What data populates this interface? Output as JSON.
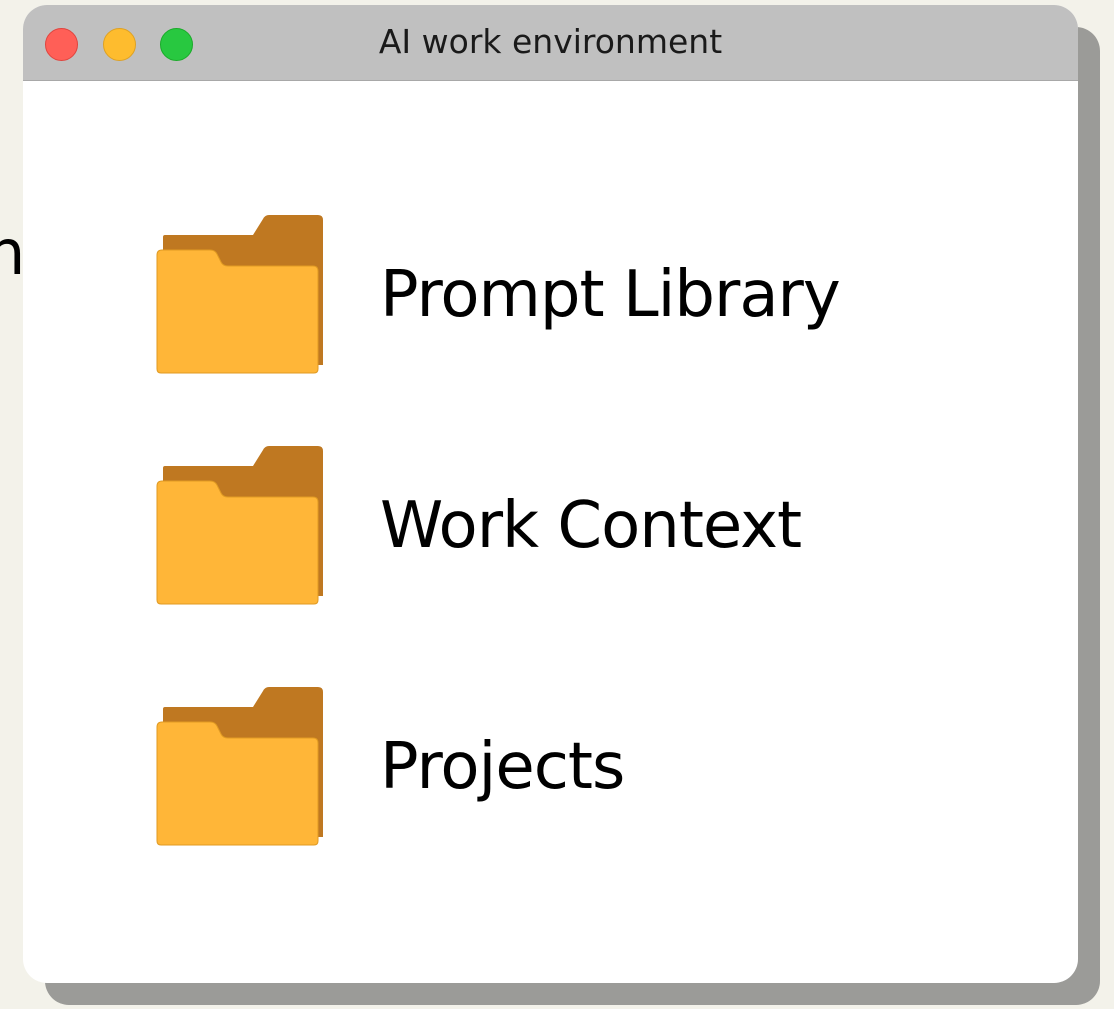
{
  "window": {
    "title": "AI work environment"
  },
  "background": {
    "partial_glyph": "n"
  },
  "folders": [
    {
      "label": "Prompt Library",
      "icon": "folder-icon"
    },
    {
      "label": "Work Context",
      "icon": "folder-icon"
    },
    {
      "label": "Projects",
      "icon": "folder-icon"
    }
  ],
  "colors": {
    "folder_front": "#ffb638",
    "folder_back": "#bf7821",
    "titlebar": "#c0c0c0",
    "close": "#ff5f57",
    "minimize": "#febc2e",
    "maximize": "#28c840"
  }
}
